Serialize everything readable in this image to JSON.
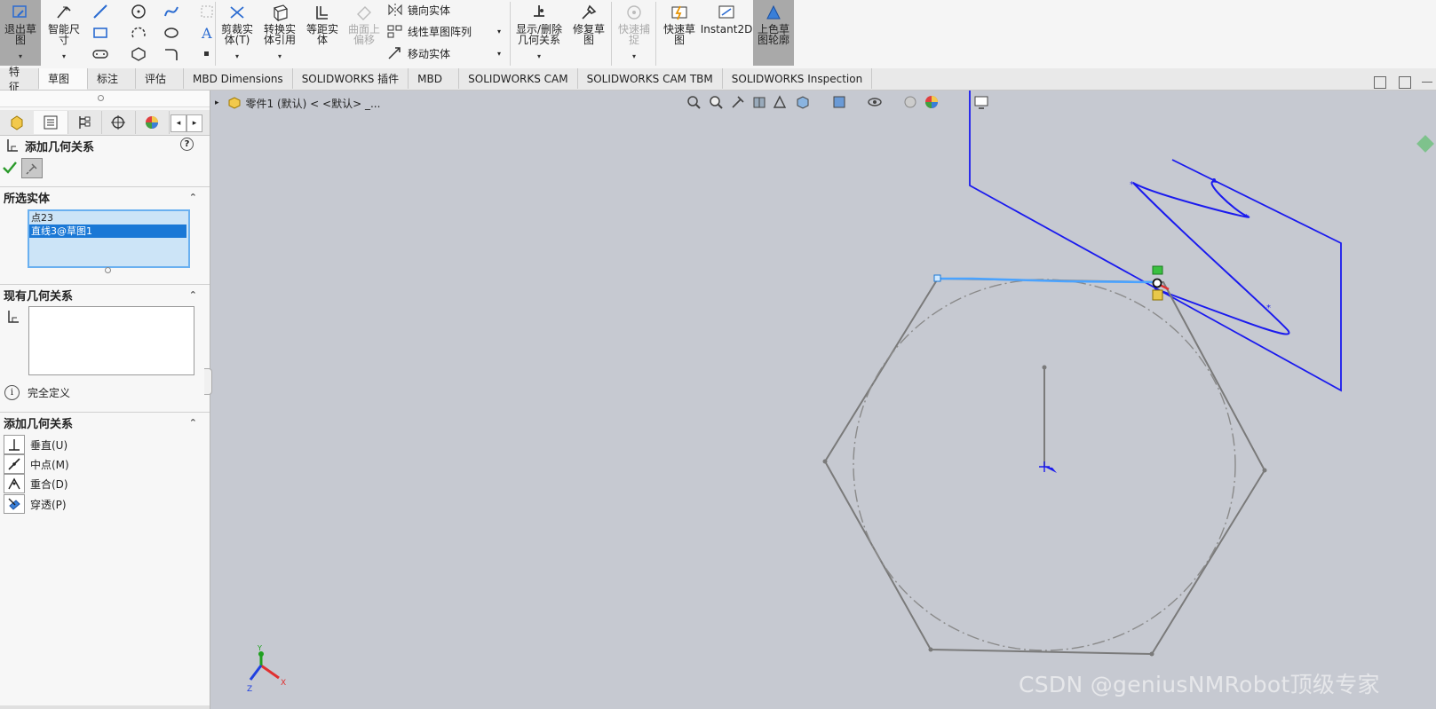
{
  "ribbon": {
    "exit_sketch": "退出草\n图",
    "smart_dim": "智能尺\n寸",
    "trim": "剪裁实\n体(T)",
    "convert": "转换实\n体引用",
    "offset": "等距实\n体",
    "surface_offset": "曲面上\n偏移",
    "mirror": "镜向实体",
    "linear_pattern": "线性草图阵列",
    "move": "移动实体",
    "display_delete": "显示/删除\n几何关系",
    "repair": "修复草\n图",
    "quick_snaps": "快速捕\n捉",
    "rapid_sketch": "快速草\n图",
    "instant2d": "Instant2D",
    "shaded": "上色草\n图轮廓"
  },
  "tabs": [
    "特征",
    "草图",
    "标注",
    "评估",
    "MBD Dimensions",
    "SOLIDWORKS 插件",
    "MBD",
    "SOLIDWORKS CAM",
    "SOLIDWORKS CAM TBM",
    "SOLIDWORKS Inspection"
  ],
  "active_tab": "草图",
  "panel": {
    "title": "添加几何关系",
    "help": "?",
    "selected_header": "所选实体",
    "selected_items": [
      "点23",
      "直线3@草图1"
    ],
    "existing_header": "现有几何关系",
    "status": "完全定义",
    "add_header": "添加几何关系",
    "relations": [
      {
        "label": "垂直(U)",
        "icon": "perpendicular-icon"
      },
      {
        "label": "中点(M)",
        "icon": "midpoint-icon"
      },
      {
        "label": "重合(D)",
        "icon": "coincident-icon"
      },
      {
        "label": "穿透(P)",
        "icon": "pierce-icon"
      }
    ]
  },
  "graphics": {
    "breadcrumb": "零件1  (默认)  < <默认> _...",
    "watermark": "CSDN @geniusNMRobot顶级专家",
    "triad": {
      "x": "X",
      "y": "Y",
      "z": "Z"
    }
  },
  "colors": {
    "sketch_blue": "#1a1aee",
    "selected_line": "#4aa3ff",
    "geometry_gray": "#7a7a7a",
    "selection_highlight": "#1a78d6",
    "ribbon_active": "#a9a9a9"
  }
}
